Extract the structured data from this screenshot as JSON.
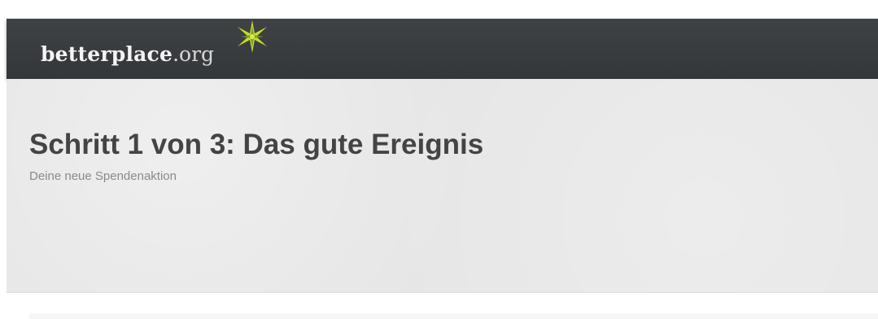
{
  "header": {
    "logo_main": "betterplace",
    "logo_suffix": ".org",
    "colors": {
      "bar": "#3a3d40",
      "star_primary": "#c7d92f",
      "star_secondary": "#6d9d2f"
    }
  },
  "hero": {
    "title": "Schritt 1 von 3: Das gute Ereignis",
    "subtitle": "Deine neue Spendenaktion"
  }
}
